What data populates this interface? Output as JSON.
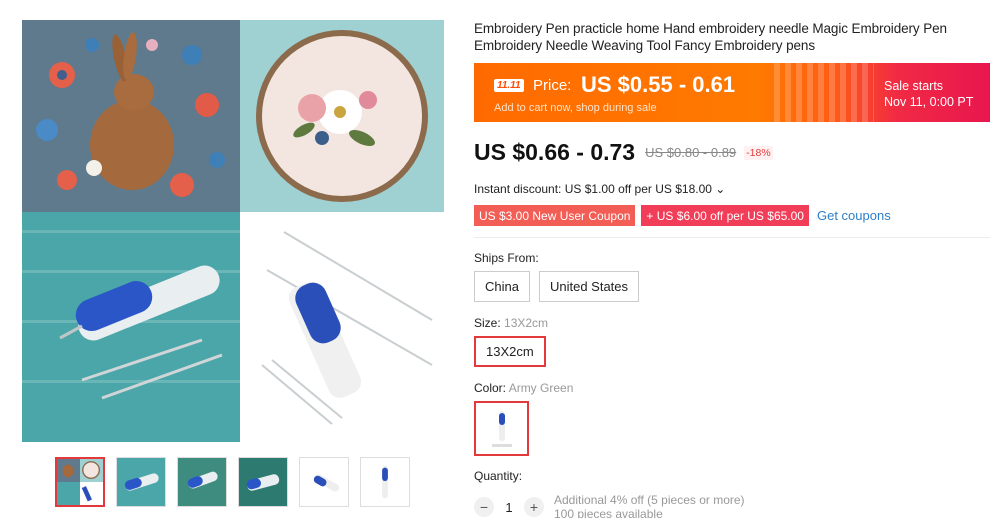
{
  "product": {
    "title": "Embroidery Pen practicle home Hand embroidery needle Magic Embroidery Pen Embroidery Needle Weaving Tool Fancy Embroidery pens"
  },
  "promo": {
    "badge": "11.11",
    "price_label": "Price:",
    "price": "US $0.55 - 0.61",
    "subtext": "Add to cart now, shop during sale",
    "sale_label": "Sale starts",
    "sale_date": "Nov 11, 0:00 PT"
  },
  "pricing": {
    "current": "US $0.66 - 0.73",
    "original": "US $0.80 - 0.89",
    "discount": "-18%"
  },
  "instant_discount": "Instant discount: US $1.00 off per US $18.00 ⌄",
  "coupons": {
    "new_user": "US $3.00 New User Coupon",
    "store": "+ US $6.00 off per US $65.00",
    "get_label": "Get coupons"
  },
  "ships_from": {
    "label": "Ships From:",
    "options": [
      "China",
      "United States"
    ]
  },
  "size": {
    "label": "Size:",
    "value": "13X2cm",
    "options": [
      "13X2cm"
    ]
  },
  "color": {
    "label": "Color:",
    "value": "Army Green"
  },
  "quantity": {
    "label": "Quantity:",
    "value": "1",
    "note": "Additional 4% off (5 pieces or more)",
    "note2": "100 pieces available"
  },
  "icons": {
    "minus": "minus-icon",
    "plus": "plus-icon",
    "chevron": "chevron-down-icon"
  },
  "colors": {
    "accent": "#e4393c",
    "promo_orange": "#ff6a00",
    "promo_pink": "#e8164e",
    "link": "#2d7fc6"
  }
}
